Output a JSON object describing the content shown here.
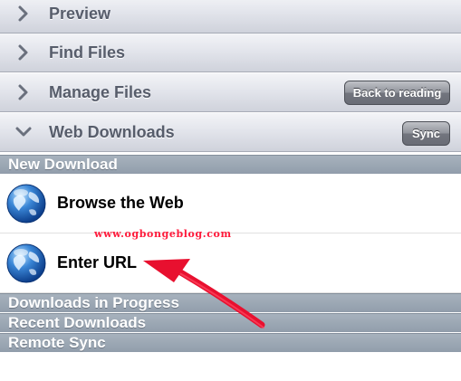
{
  "nav": {
    "items": [
      {
        "label": "Preview",
        "expanded": false
      },
      {
        "label": "Find Files",
        "expanded": false
      },
      {
        "label": "Manage Files",
        "expanded": false,
        "button": "Back to reading"
      },
      {
        "label": "Web Downloads",
        "expanded": true,
        "button": "Sync"
      }
    ]
  },
  "sections": {
    "new_download": "New Download",
    "downloads_in_progress": "Downloads in Progress",
    "recent_downloads": "Recent Downloads",
    "remote_sync": "Remote Sync"
  },
  "new_download_items": [
    {
      "label": "Browse the Web",
      "icon": "globe-icon"
    },
    {
      "label": "Enter URL",
      "icon": "globe-icon"
    }
  ],
  "annotation": {
    "watermark": "www.ogbongeblog.com",
    "arrow_color": "#e8102f"
  },
  "colors": {
    "section_header": "#9aa5b2",
    "nav_text": "#575d6b",
    "button": "#7a7d86"
  }
}
